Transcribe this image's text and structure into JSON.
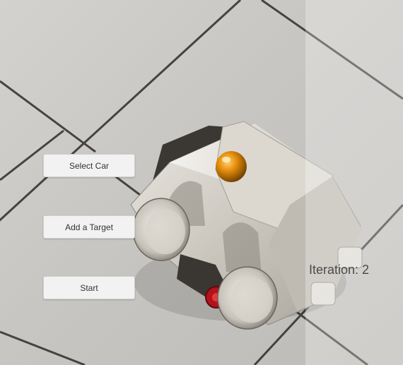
{
  "buttons": {
    "select_car": "Select Car",
    "add_target": "Add a Target",
    "start": "Start"
  },
  "status": {
    "iteration_text": "Iteration: 2"
  },
  "colors": {
    "button_bg": "#f2f2f2",
    "target_sphere": "#e8900c",
    "floor": "#cfcdc9",
    "grout": "#2e2b28"
  }
}
